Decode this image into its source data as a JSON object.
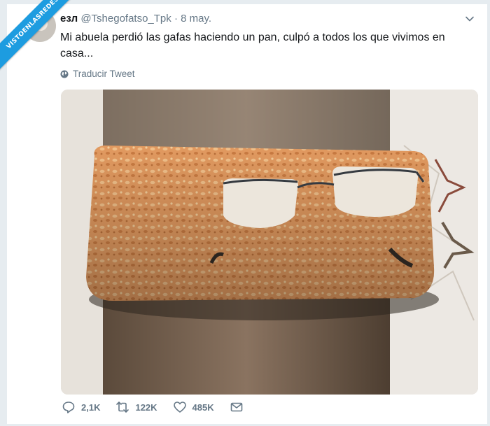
{
  "watermark": "VISTOENLASREDES",
  "tweet": {
    "display_name": "езл",
    "handle": "@Tshegofatso_Tpk",
    "separator": "·",
    "date": "8 may.",
    "text": "Mi abuela perdió las gafas haciendo un pan, culpó a todos los que vivimos en casa...",
    "translate_label": "Traducir Tweet",
    "replies": "2,1K",
    "retweets": "122K",
    "likes": "485K"
  },
  "icons": {
    "avatar": "user-avatar",
    "menu": "chevron-down-icon",
    "translate": "globe-icon",
    "reply": "comment-icon",
    "retweet": "retweet-icon",
    "like": "heart-icon",
    "dm": "envelope-icon"
  },
  "colors": {
    "accent": "#1d9ce0",
    "text": "#14171a",
    "muted": "#657786",
    "page_background": "#e6ecf0"
  }
}
